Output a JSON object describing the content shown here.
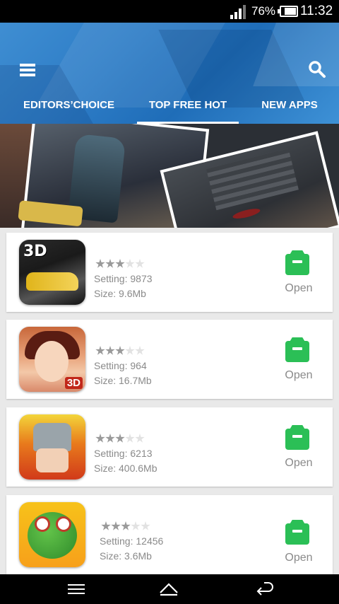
{
  "status_bar": {
    "battery_percent": "76%",
    "time": "11:32"
  },
  "header": {
    "tabs": [
      {
        "label": "EDITORS’CHOICE",
        "active": false
      },
      {
        "label": "TOP FREE HOT",
        "active": true
      },
      {
        "label": "NEW APPS",
        "active": false
      }
    ]
  },
  "apps": [
    {
      "icon": "racing-car-3d-icon",
      "rating": 3,
      "setting": "Setting: 9873",
      "size": "Size: 9.6Mb",
      "action": "Open"
    },
    {
      "icon": "warrior-princess-3d-icon",
      "rating": 3,
      "setting": "Setting:  964",
      "size": "Size: 16.7Mb",
      "action": "Open"
    },
    {
      "icon": "knight-helmet-icon",
      "rating": 3,
      "setting": "Setting:  6213",
      "size": "Size: 400.6Mb",
      "action": "Open"
    },
    {
      "icon": "frog-glasses-icon",
      "rating": 3,
      "setting": "Setting:  12456",
      "size": "Size: 3.6Mb",
      "action": "Open"
    }
  ],
  "colors": {
    "header_blue": "#2d7cc6",
    "open_green": "#2bbf56",
    "meta_gray": "#8a8a8a"
  }
}
